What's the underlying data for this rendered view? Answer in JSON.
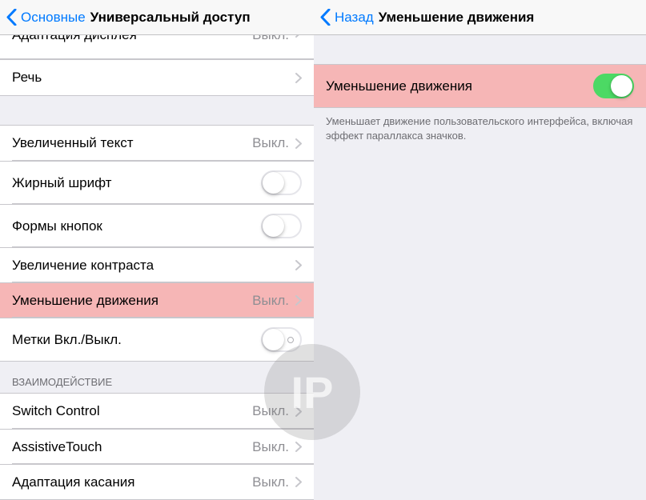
{
  "left": {
    "nav": {
      "back": "Основные",
      "title": "Универсальный доступ"
    },
    "partial": {
      "label": "Адаптация дисплея",
      "value": "Выкл."
    },
    "group1": [
      {
        "label": "Речь",
        "kind": "disclosure"
      }
    ],
    "group2": [
      {
        "label": "Увеличенный текст",
        "kind": "value",
        "value": "Выкл."
      },
      {
        "label": "Жирный шрифт",
        "kind": "toggle",
        "on": false
      },
      {
        "label": "Формы кнопок",
        "kind": "toggle",
        "on": false
      },
      {
        "label": "Увеличение контраста",
        "kind": "disclosure"
      },
      {
        "label": "Уменьшение движения",
        "kind": "value",
        "value": "Выкл.",
        "highlight": true
      },
      {
        "label": "Метки Вкл./Выкл.",
        "kind": "toggle",
        "on": false,
        "labeled": true
      }
    ],
    "section2_header": "ВЗАИМОДЕЙСТВИЕ",
    "group3": [
      {
        "label": "Switch Control",
        "kind": "value",
        "value": "Выкл."
      },
      {
        "label": "AssistiveTouch",
        "kind": "value",
        "value": "Выкл."
      },
      {
        "label": "Адаптация касания",
        "kind": "value",
        "value": "Выкл."
      }
    ]
  },
  "right": {
    "nav": {
      "back": "Назад",
      "title": "Уменьшение движения"
    },
    "row": {
      "label": "Уменьшение движения",
      "on": true,
      "highlight": true
    },
    "footer": "Уменьшает движение пользовательского интерфейса, включая эффект параллакса значков."
  },
  "watermark": "IP"
}
